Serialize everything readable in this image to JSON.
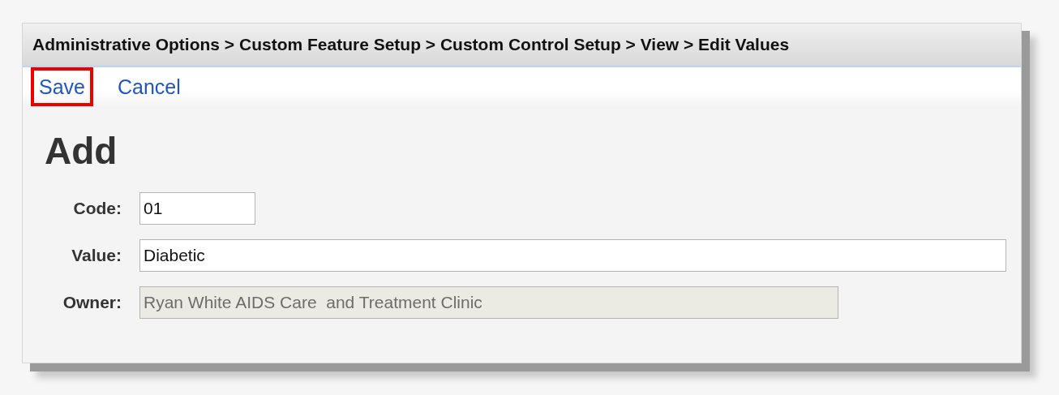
{
  "breadcrumb": "Administrative Options > Custom Feature Setup > Custom Control Setup > View > Edit Values",
  "actions": [
    {
      "label": "Save",
      "highlighted": true
    },
    {
      "label": "Cancel",
      "highlighted": false
    }
  ],
  "heading": "Add",
  "fields": [
    {
      "label": "Code:",
      "value": "01",
      "disabled": false
    },
    {
      "label": "Value:",
      "value": "Diabetic",
      "disabled": false
    },
    {
      "label": "Owner:",
      "value": "Ryan White AIDS Care  and Treatment Clinic",
      "disabled": true
    }
  ]
}
